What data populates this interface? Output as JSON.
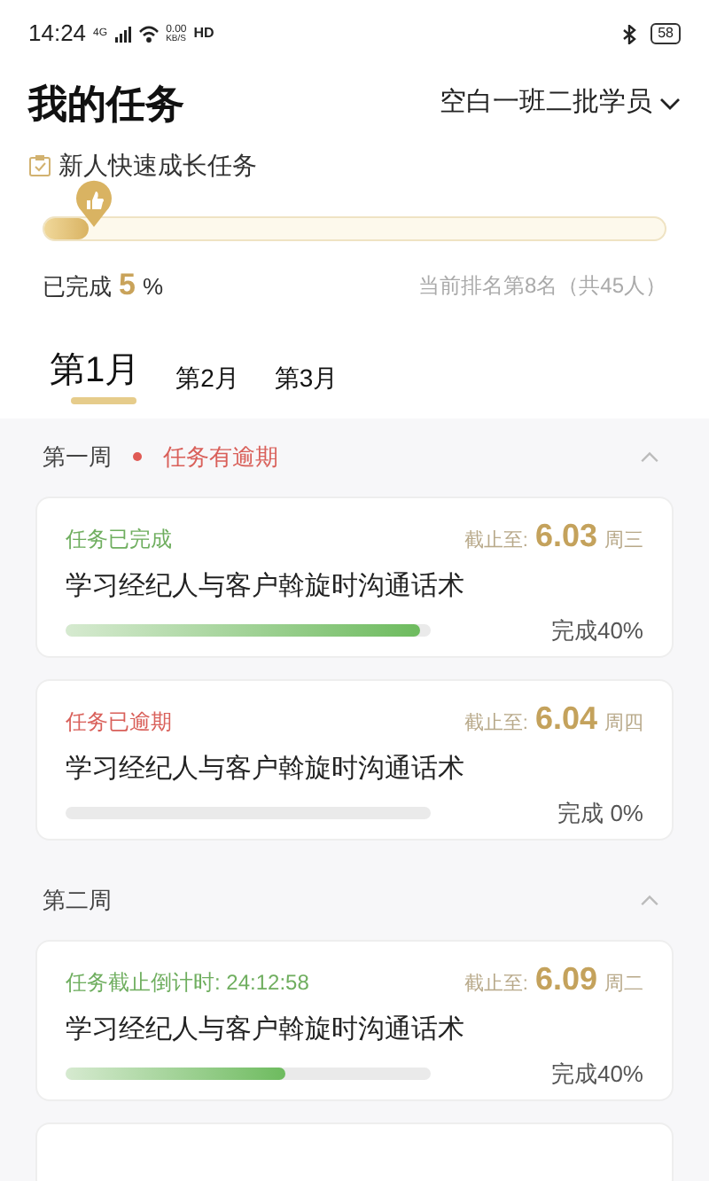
{
  "status_bar": {
    "time": "14:24",
    "network": "4G",
    "speed": "0.00",
    "speed_unit": "KB/S",
    "hd": "HD",
    "battery": "58"
  },
  "header": {
    "title": "我的任务",
    "class_selector": "空白一班二批学员"
  },
  "task_group": {
    "label": "新人快速成长任务",
    "level": 0.07,
    "completed_label": "已完成",
    "completed_value": "5",
    "completed_unit": "%",
    "rank": "当前排名第8名（共45人）"
  },
  "tabs": [
    {
      "prefix": "第",
      "number": "1",
      "suffix": "月",
      "selected": true
    },
    {
      "prefix": "第",
      "number": "2",
      "suffix": "月",
      "selected": false
    },
    {
      "prefix": "第",
      "number": "3",
      "suffix": "月",
      "selected": false
    }
  ],
  "weeks": [
    {
      "title": "第一周",
      "alert": "任务有逾期",
      "expanded": true,
      "tasks": [
        {
          "kind": "done",
          "status": "任务已完成",
          "deadline_label": "截止至:",
          "deadline_date": "6.03",
          "deadline_day": "周三",
          "name": "学习经纪人与客户斡旋时沟通话术",
          "level": 0.97,
          "progress": "完成40%"
        },
        {
          "kind": "overdue",
          "status": "任务已逾期",
          "deadline_label": "截止至:",
          "deadline_date": "6.04",
          "deadline_day": "周四",
          "name": "学习经纪人与客户斡旋时沟通话术",
          "level": 0,
          "progress": "完成 0%"
        }
      ]
    },
    {
      "title": "第二周",
      "expanded": true,
      "tasks": [
        {
          "kind": "countdown",
          "status": "任务截止倒计时: 24:12:58",
          "deadline_label": "截止至:",
          "deadline_date": "6.09",
          "deadline_day": "周二",
          "name": "学习经纪人与客户斡旋时沟通话术",
          "level": 0.6,
          "progress": "完成40%"
        }
      ]
    }
  ]
}
